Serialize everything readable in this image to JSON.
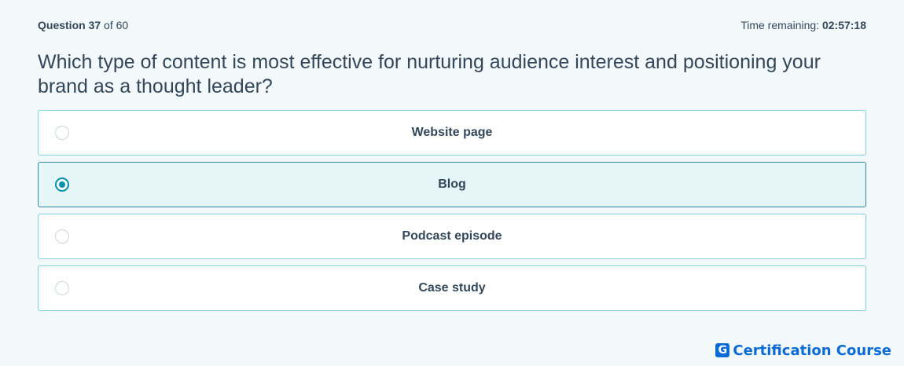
{
  "header": {
    "question_label": "Question",
    "question_number": "37",
    "of_text": "of",
    "total": "60",
    "time_label": "Time remaining:",
    "time_value": "02:57:18"
  },
  "question": {
    "text": "Which type of content is most effective for nurturing audience interest and positioning your brand as a thought leader?"
  },
  "options": [
    {
      "label": "Website page",
      "selected": false
    },
    {
      "label": "Blog",
      "selected": true
    },
    {
      "label": "Podcast episode",
      "selected": false
    },
    {
      "label": "Case study",
      "selected": false
    }
  ],
  "brand": {
    "logo_letter": "G",
    "name": "Certification Course",
    "color": "#0b6bd6"
  },
  "colors": {
    "accent": "#0091ae",
    "selected_bg": "#e5f5f8",
    "option_border": "#7fd1de",
    "text": "#33475b"
  }
}
